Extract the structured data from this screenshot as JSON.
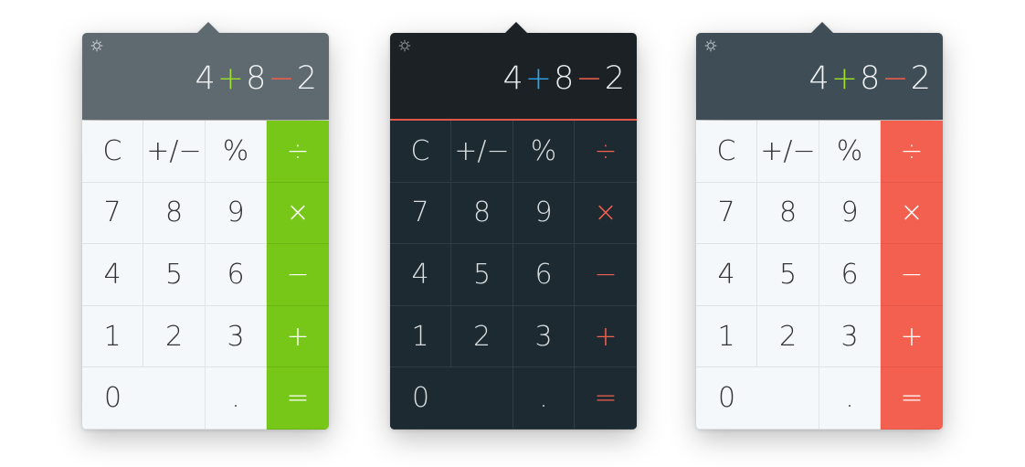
{
  "calculators": [
    {
      "theme": "light-green",
      "accent": "#76c717",
      "display": {
        "n1": "4",
        "op1": "+",
        "n2": "8",
        "op2": "−",
        "n3": "2"
      },
      "keys": {
        "clear": "C",
        "sign": "+∕−",
        "percent": "%",
        "divide": "÷",
        "seven": "7",
        "eight": "8",
        "nine": "9",
        "multiply": "×",
        "four": "4",
        "five": "5",
        "six": "6",
        "minus": "−",
        "one": "1",
        "two": "2",
        "three": "3",
        "plus": "+",
        "zero": "0",
        "decimal": ".",
        "equals": "="
      },
      "settings_icon": "gear-icon"
    },
    {
      "theme": "dark",
      "accent": "#f4604f",
      "display": {
        "n1": "4",
        "op1": "+",
        "n2": "8",
        "op2": "−",
        "n3": "2"
      },
      "keys": {
        "clear": "C",
        "sign": "+∕−",
        "percent": "%",
        "divide": "÷",
        "seven": "7",
        "eight": "8",
        "nine": "9",
        "multiply": "×",
        "four": "4",
        "five": "5",
        "six": "6",
        "minus": "−",
        "one": "1",
        "two": "2",
        "three": "3",
        "plus": "+",
        "zero": "0",
        "decimal": ".",
        "equals": "="
      },
      "settings_icon": "gear-icon"
    },
    {
      "theme": "light-red",
      "accent": "#f4604f",
      "display": {
        "n1": "4",
        "op1": "+",
        "n2": "8",
        "op2": "−",
        "n3": "2"
      },
      "keys": {
        "clear": "C",
        "sign": "+∕−",
        "percent": "%",
        "divide": "÷",
        "seven": "7",
        "eight": "8",
        "nine": "9",
        "multiply": "×",
        "four": "4",
        "five": "5",
        "six": "6",
        "minus": "−",
        "one": "1",
        "two": "2",
        "three": "3",
        "plus": "+",
        "zero": "0",
        "decimal": ".",
        "equals": "="
      },
      "settings_icon": "gear-icon"
    }
  ]
}
